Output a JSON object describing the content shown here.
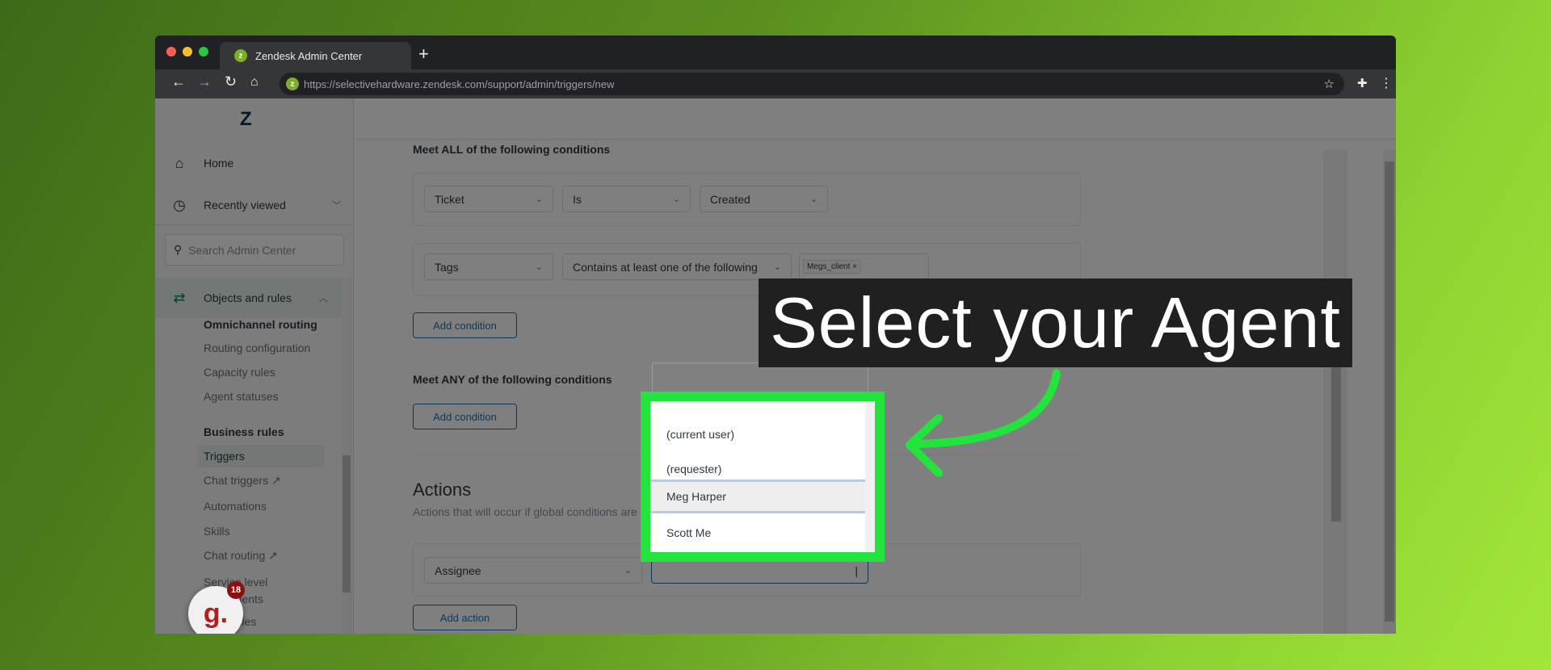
{
  "browser": {
    "tab_title": "Zendesk Admin Center",
    "url": "https://selectivehardware.zendesk.com/support/admin/triggers/new",
    "new_tab": "+"
  },
  "sidebar": {
    "home": "Home",
    "recently_viewed": "Recently viewed",
    "search_placeholder": "Search Admin Center",
    "section": "Objects and rules",
    "groups": [
      {
        "title": "Omnichannel routing",
        "items": [
          "Routing configuration",
          "Capacity rules",
          "Agent statuses"
        ]
      },
      {
        "title": "Business rules",
        "items": [
          "Triggers",
          "Chat triggers",
          "Automations",
          "Skills",
          "Chat routing",
          "Service level agreements",
          "Schedules"
        ]
      }
    ],
    "active": "Triggers",
    "badge_count": "18",
    "badge_logo": "g."
  },
  "main": {
    "all_title": "Meet ALL of the following conditions",
    "cond1": {
      "field": "Ticket",
      "op": "Is",
      "value": "Created"
    },
    "cond2": {
      "field": "Tags",
      "op": "Contains at least one of the following",
      "tag": "Megs_client"
    },
    "add_condition": "Add condition",
    "any_title": "Meet ANY of the following conditions",
    "actions_title": "Actions",
    "actions_sub": "Actions that will occur if global conditions are",
    "action1": {
      "field": "Assignee",
      "value": ""
    },
    "add_action": "Add action"
  },
  "dropdown": {
    "options": [
      "(current user)",
      "(requester)",
      "Meg Harper",
      "Scott Me"
    ],
    "highlighted": "Meg Harper"
  },
  "callout": {
    "text": "Select your Agent"
  },
  "colors": {
    "highlight": "#22e43c",
    "accent": "#1f73b7",
    "callout_bg": "#202020"
  }
}
